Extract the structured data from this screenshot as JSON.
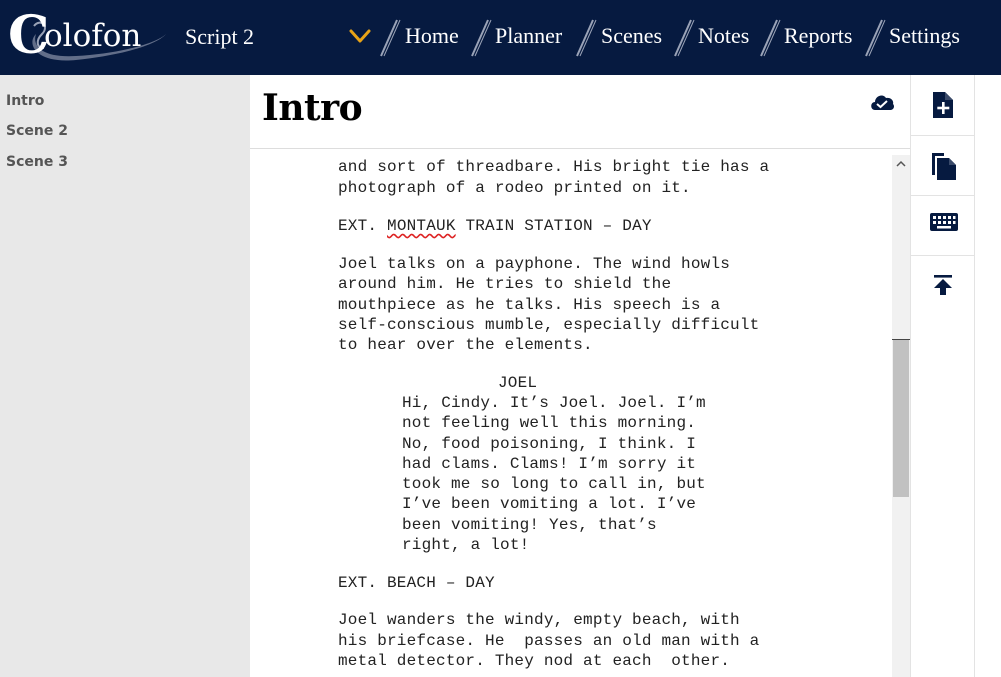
{
  "app": {
    "logo_initial": "C",
    "logo_rest": "olofon",
    "script_title": "Script 2"
  },
  "nav": {
    "items": [
      {
        "label": "Home"
      },
      {
        "label": "Planner"
      },
      {
        "label": "Scenes"
      },
      {
        "label": "Notes"
      },
      {
        "label": "Reports"
      },
      {
        "label": "Settings"
      }
    ]
  },
  "sidebar": {
    "scenes": [
      {
        "label": "Intro"
      },
      {
        "label": "Scene 2"
      },
      {
        "label": "Scene 3"
      }
    ]
  },
  "document": {
    "title": "Intro",
    "lines": [
      "and sort of threadbare. His bright tie has a",
      "photograph of a rodeo printed on it.",
      "EXT. ",
      "MONTAUK",
      " TRAIN STATION – DAY",
      "Joel talks on a payphone. The wind howls",
      "around him. He tries to shield the",
      "mouthpiece as he talks. His speech is a",
      "self-conscious mumble, especially difficult",
      "to hear over the elements.",
      "JOEL",
      "Hi, Cindy. It’s Joel. Joel. I’m",
      "not feeling well this morning.",
      "No, food poisoning, I think. I",
      "had clams. Clams! I’m sorry it",
      "took me so long to call in, but",
      "I’ve been vomiting a lot. I’ve",
      "been vomiting! Yes, that’s",
      "right, a lot!",
      "EXT. BEACH – DAY",
      "Joel wanders the windy, empty beach, with",
      "his briefcase. He  passes an old man with a",
      "metal detector. They nod at each  other."
    ]
  },
  "toolbar": {
    "icons": [
      "new-file-icon",
      "copy-icon",
      "keyboard-icon",
      "scroll-to-top-icon"
    ]
  },
  "colors": {
    "header_bg": "#061a40",
    "accent": "#e8a317",
    "sidebar_bg": "#e8e8e8"
  }
}
